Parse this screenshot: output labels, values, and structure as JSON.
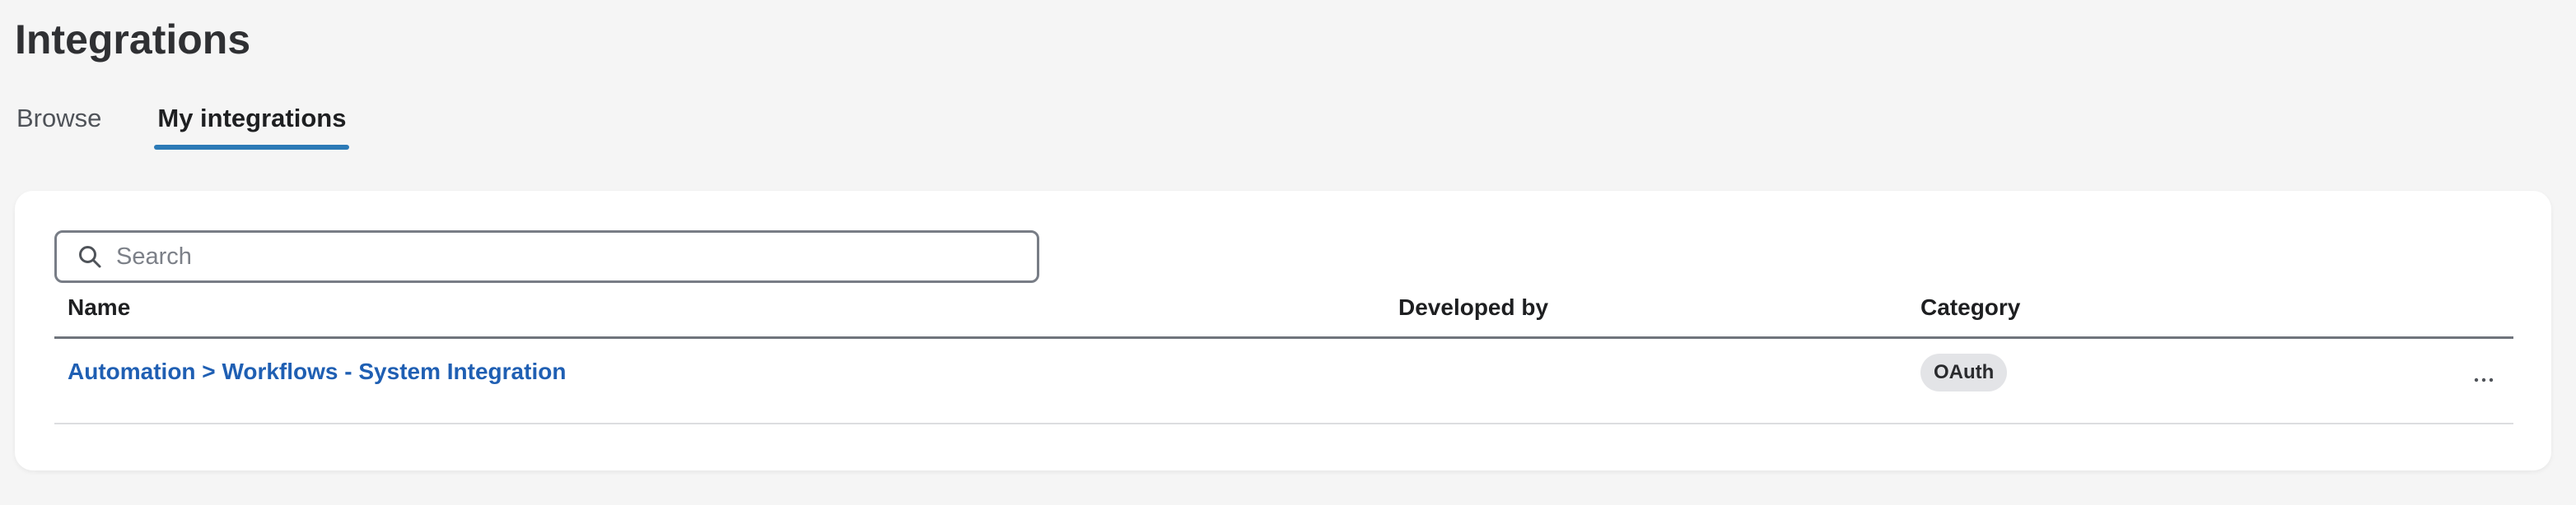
{
  "header": {
    "title": "Integrations"
  },
  "tabs": [
    {
      "label": "Browse",
      "active": false
    },
    {
      "label": "My integrations",
      "active": true
    }
  ],
  "search": {
    "placeholder": "Search",
    "value": ""
  },
  "table": {
    "columns": [
      "Name",
      "Developed by",
      "Category"
    ],
    "rows": [
      {
        "name": "Automation > Workflows - System Integration",
        "developed_by": "",
        "category": "OAuth",
        "actions_icon": "more-horizontal-icon"
      }
    ]
  },
  "colors": {
    "background": "#f5f5f5",
    "card": "#ffffff",
    "accent": "#2c7ab6",
    "link": "#1f5fb3",
    "badge_bg": "#e3e4e7"
  }
}
